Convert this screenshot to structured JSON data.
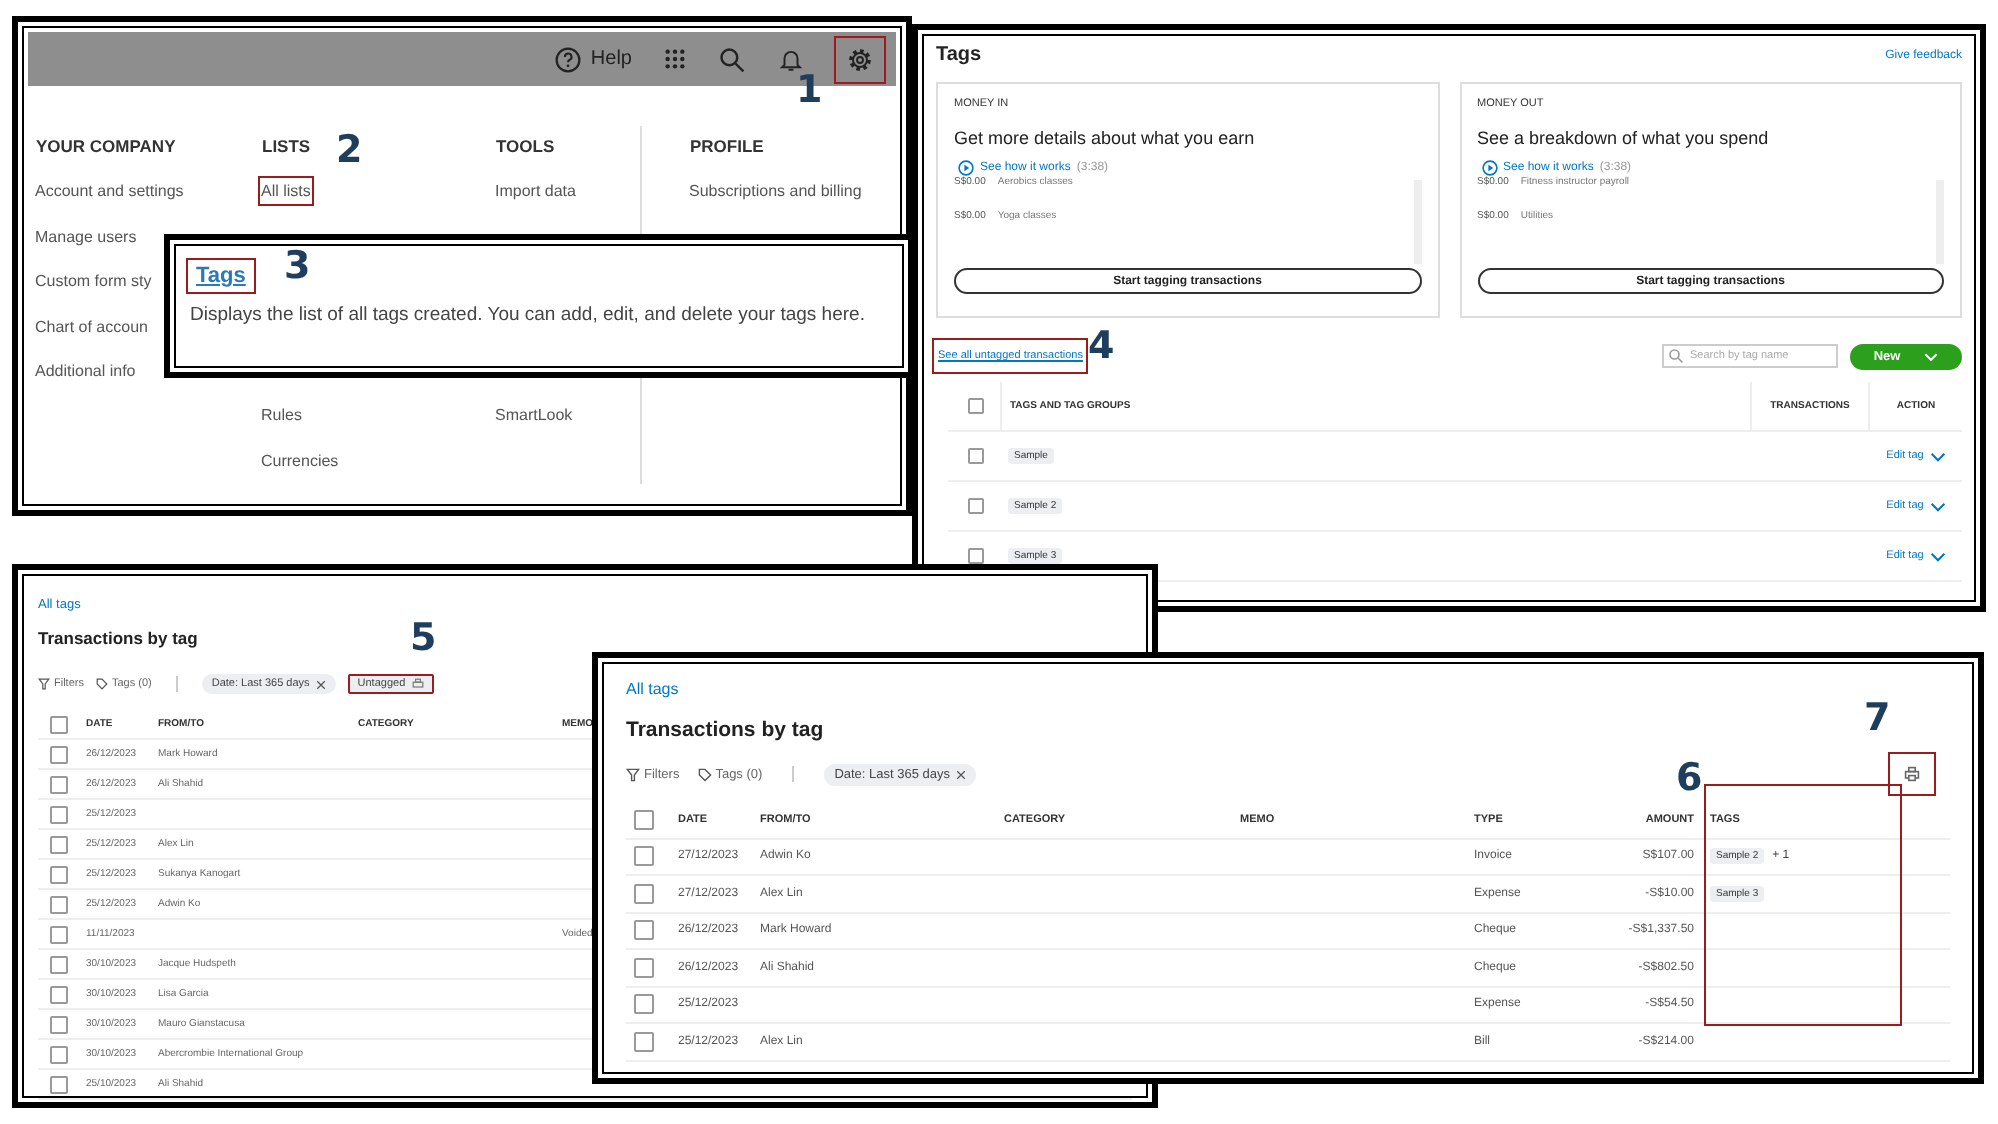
{
  "steps": [
    "1",
    "2",
    "3",
    "4",
    "5",
    "6",
    "7"
  ],
  "settings_menu": {
    "help": "Help",
    "gear_highlighted": true,
    "columns": [
      {
        "heading": "YOUR COMPANY",
        "items": [
          {
            "label": "Account and settings",
            "highlighted": false
          },
          {
            "label": "Manage users",
            "highlighted": false
          },
          {
            "label": "Custom form sty",
            "highlighted": false
          },
          {
            "label": "Chart of accoun",
            "highlighted": false
          },
          {
            "label": "Additional info",
            "highlighted": false
          }
        ]
      },
      {
        "heading": "LISTS",
        "items": [
          {
            "label": "All lists",
            "highlighted": true
          }
        ],
        "items_below": [
          {
            "label": "Rules",
            "highlighted": false
          },
          {
            "label": "Currencies",
            "highlighted": false
          }
        ]
      },
      {
        "heading": "TOOLS",
        "items": [
          {
            "label": "Import data",
            "highlighted": false
          }
        ],
        "items_below": [
          {
            "label": "SmartLook",
            "highlighted": false
          }
        ]
      },
      {
        "heading": "PROFILE",
        "items": [
          {
            "label": "Subscriptions and billing",
            "highlighted": false
          }
        ]
      }
    ]
  },
  "tags_tooltip": {
    "title": "Tags",
    "highlighted": true,
    "description": "Displays the list of all tags created. You can add, edit, and delete your tags here."
  },
  "tags_page": {
    "title": "Tags",
    "feedback": "Give feedback",
    "cards": [
      {
        "label": "MONEY IN",
        "heading": "Get more details about what you earn",
        "video_link": "See how it works",
        "duration": "(3:38)",
        "entries": [
          {
            "amount": "S$0.00",
            "name": "Aerobics classes"
          },
          {
            "amount": "S$0.00",
            "name": "Yoga classes"
          }
        ],
        "button": "Start tagging transactions"
      },
      {
        "label": "MONEY OUT",
        "heading": "See a breakdown of what you spend",
        "video_link": "See how it works",
        "duration": "(3:38)",
        "entries": [
          {
            "amount": "S$0.00",
            "name": "Fitness instructor payroll"
          },
          {
            "amount": "S$0.00",
            "name": "Utilities"
          }
        ],
        "button": "Start tagging transactions"
      }
    ],
    "untagged_link": {
      "label": "See all untagged transactions",
      "highlighted": true
    },
    "search": {
      "placeholder": "Search by tag name"
    },
    "new_button": "New",
    "columns": [
      "TAGS AND TAG GROUPS",
      "TRANSACTIONS",
      "ACTION"
    ],
    "select_all_checked": false,
    "rows": [
      {
        "tag": "Sample",
        "action": "Edit tag",
        "checked": false
      },
      {
        "tag": "Sample 2",
        "action": "Edit tag",
        "checked": false
      },
      {
        "tag": "Sample 3",
        "action": "Edit tag",
        "checked": false
      }
    ]
  },
  "untagged_report": {
    "breadcrumb": "All tags",
    "title": "Transactions by tag",
    "filters": "Filters",
    "tags_filter": "Tags (0)",
    "chips": [
      {
        "label": "Date: Last 365 days",
        "kind": "removable",
        "highlighted": false
      },
      {
        "label": "Untagged",
        "kind": "icon",
        "highlighted": true
      }
    ],
    "columns": [
      "DATE",
      "FROM/TO",
      "CATEGORY",
      "MEMO"
    ],
    "select_all_checked": false,
    "rows": [
      {
        "date": "26/12/2023",
        "from_to": "Mark Howard",
        "checked": false
      },
      {
        "date": "26/12/2023",
        "from_to": "Ali Shahid",
        "checked": false
      },
      {
        "date": "25/12/2023",
        "checked": false
      },
      {
        "date": "25/12/2023",
        "from_to": "Alex Lin",
        "checked": false
      },
      {
        "date": "25/12/2023",
        "from_to": "Sukanya Kanogart",
        "checked": false
      },
      {
        "date": "25/12/2023",
        "from_to": "Adwin Ko",
        "checked": false
      },
      {
        "date": "11/11/2023",
        "memo": "Voided",
        "checked": false
      },
      {
        "date": "30/10/2023",
        "from_to": "Jacque Hudspeth",
        "checked": false
      },
      {
        "date": "30/10/2023",
        "from_to": "Lisa Garcia",
        "checked": false
      },
      {
        "date": "30/10/2023",
        "from_to": "Mauro Gianstacusa",
        "checked": false
      },
      {
        "date": "30/10/2023",
        "from_to": "Abercrombie International Group",
        "checked": false
      },
      {
        "date": "25/10/2023",
        "from_to": "Ali Shahid",
        "checked": false
      }
    ]
  },
  "tagged_report": {
    "breadcrumb": "All tags",
    "title": "Transactions by tag",
    "filters": "Filters",
    "tags_filter": "Tags (0)",
    "chips": [
      {
        "label": "Date: Last 365 days",
        "kind": "removable",
        "highlighted": false
      }
    ],
    "print_highlighted": true,
    "tags_column_highlighted": true,
    "columns": [
      "DATE",
      "FROM/TO",
      "CATEGORY",
      "MEMO",
      "TYPE",
      "AMOUNT",
      "TAGS"
    ],
    "select_all_checked": false,
    "rows": [
      {
        "date": "27/12/2023",
        "from_to": "Adwin Ko",
        "type": "Invoice",
        "amount": "S$107.00",
        "tags": [
          "Sample 2"
        ],
        "more": "+ 1",
        "checked": false
      },
      {
        "date": "27/12/2023",
        "from_to": "Alex Lin",
        "type": "Expense",
        "amount": "-S$10.00",
        "tags": [
          "Sample 3"
        ],
        "checked": false
      },
      {
        "date": "26/12/2023",
        "from_to": "Mark Howard",
        "type": "Cheque",
        "amount": "-S$1,337.50",
        "tags": [],
        "checked": false
      },
      {
        "date": "26/12/2023",
        "from_to": "Ali Shahid",
        "type": "Cheque",
        "amount": "-S$802.50",
        "tags": [],
        "checked": false
      },
      {
        "date": "25/12/2023",
        "type": "Expense",
        "amount": "-S$54.50",
        "tags": [],
        "checked": false
      },
      {
        "date": "25/12/2023",
        "from_to": "Alex Lin",
        "type": "Bill",
        "amount": "-S$214.00",
        "tags": [],
        "checked": false
      }
    ]
  }
}
